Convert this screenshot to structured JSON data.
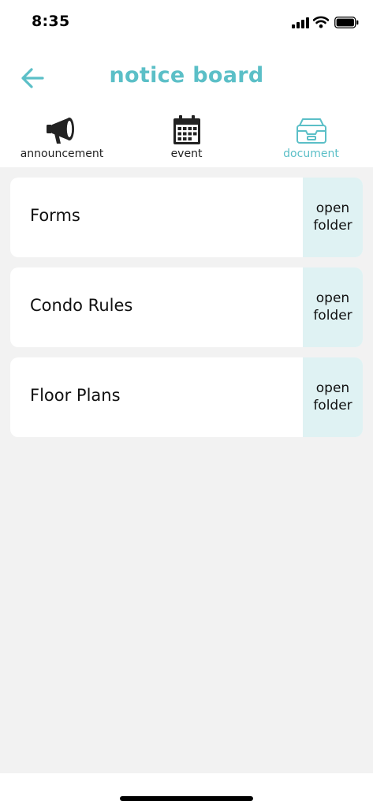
{
  "status_bar": {
    "time": "8:35",
    "icons": [
      "cellular-signal-icon",
      "wifi-icon",
      "battery-icon"
    ]
  },
  "header": {
    "title": "notice board",
    "back_icon": "arrow-left-icon"
  },
  "tabs": [
    {
      "label": "announcement",
      "icon": "megaphone-icon",
      "active": false
    },
    {
      "label": "event",
      "icon": "calendar-icon",
      "active": false
    },
    {
      "label": "document",
      "icon": "archive-tray-icon",
      "active": true
    }
  ],
  "folders": [
    {
      "name": "Forms",
      "action_label": "open folder"
    },
    {
      "name": "Condo Rules",
      "action_label": "open folder"
    },
    {
      "name": "Floor Plans",
      "action_label": "open folder"
    }
  ],
  "colors": {
    "accent": "#5bbfc7",
    "action_background": "#dff2f3",
    "page_background": "#f2f2f2",
    "card_background": "#ffffff",
    "text": "#111111"
  }
}
